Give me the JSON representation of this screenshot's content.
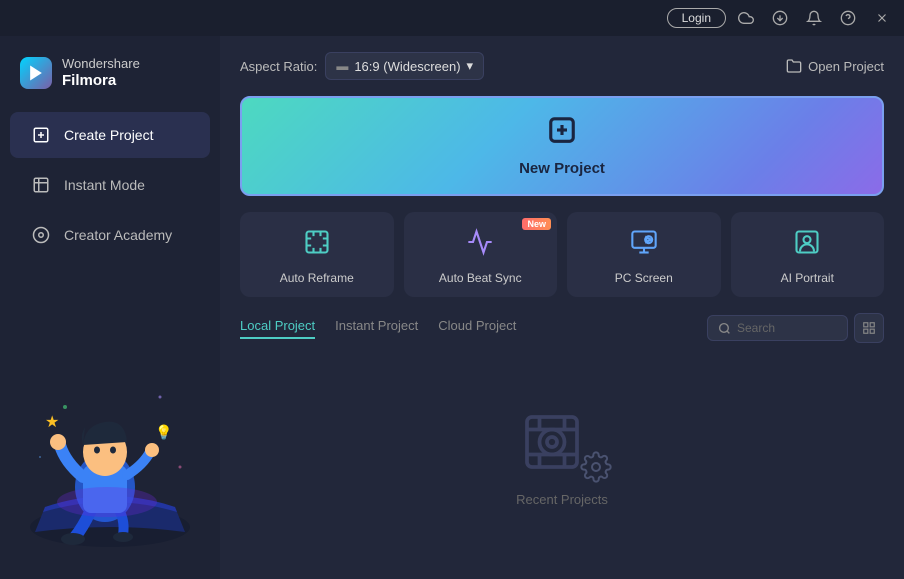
{
  "titlebar": {
    "login_label": "Login",
    "icons": [
      "cloud",
      "download",
      "bell",
      "question",
      "close"
    ]
  },
  "sidebar": {
    "brand": "Wondershare",
    "product": "Filmora",
    "nav_items": [
      {
        "id": "create-project",
        "label": "Create Project",
        "active": true
      },
      {
        "id": "instant-mode",
        "label": "Instant Mode",
        "active": false
      },
      {
        "id": "creator-academy",
        "label": "Creator Academy",
        "active": false
      }
    ]
  },
  "content": {
    "aspect_ratio_label": "Aspect Ratio:",
    "aspect_ratio_value": "16:9 (Widescreen)",
    "open_project_label": "Open Project",
    "new_project_label": "New Project",
    "quick_actions": [
      {
        "id": "auto-reframe",
        "label": "Auto Reframe",
        "badge": null
      },
      {
        "id": "auto-beat-sync",
        "label": "Auto Beat Sync",
        "badge": "New"
      },
      {
        "id": "pc-screen",
        "label": "PC Screen",
        "badge": null
      },
      {
        "id": "ai-portrait",
        "label": "AI Portrait",
        "badge": null
      }
    ],
    "project_tabs": [
      {
        "id": "local",
        "label": "Local Project",
        "active": true
      },
      {
        "id": "instant",
        "label": "Instant Project",
        "active": false
      },
      {
        "id": "cloud",
        "label": "Cloud Project",
        "active": false
      }
    ],
    "search_placeholder": "Search",
    "empty_state_label": "Recent Projects"
  }
}
